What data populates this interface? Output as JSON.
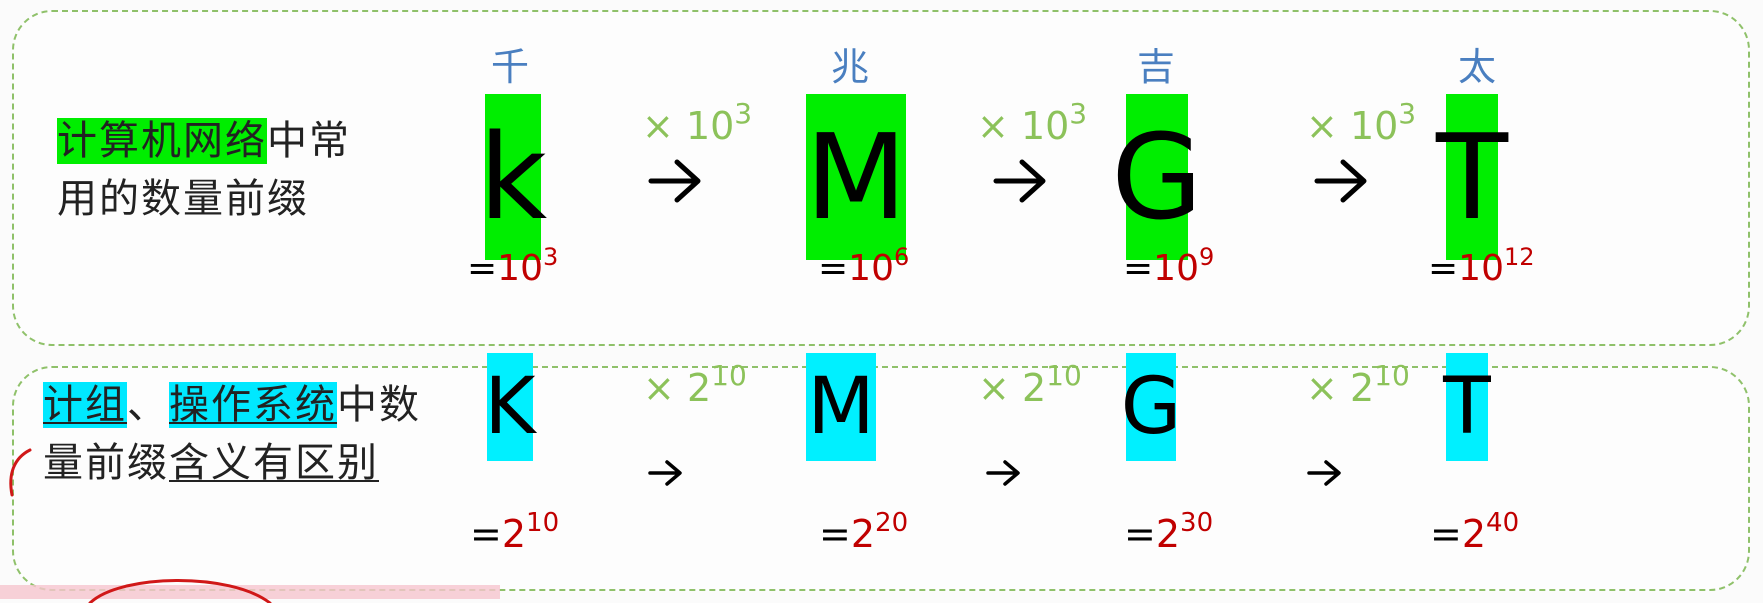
{
  "top": {
    "description": {
      "highlight": "计算机网络",
      "rest_line1": "中常",
      "line2": "用的数量前缀"
    },
    "prefixes": [
      {
        "chinese": "千",
        "letter": "k",
        "base": "10",
        "exp": "3"
      },
      {
        "chinese": "兆",
        "letter": "M",
        "base": "10",
        "exp": "6"
      },
      {
        "chinese": "吉",
        "letter": "G",
        "base": "10",
        "exp": "9"
      },
      {
        "chinese": "太",
        "letter": "T",
        "base": "10",
        "exp": "12"
      }
    ],
    "multiplier": {
      "sign": "×",
      "base": "10",
      "exp": "3"
    },
    "highlight_color": "#00ee00"
  },
  "bottom": {
    "description": {
      "hl1": "计组",
      "sep": "、",
      "hl2": "操作系统",
      "rest_line1": "中数",
      "line2_plain": "量前缀",
      "line2_underlined": "含义有区别"
    },
    "prefixes": [
      {
        "letter": "K",
        "base": "2",
        "exp": "10"
      },
      {
        "letter": "M",
        "base": "2",
        "exp": "20"
      },
      {
        "letter": "G",
        "base": "2",
        "exp": "30"
      },
      {
        "letter": "T",
        "base": "2",
        "exp": "40"
      }
    ],
    "multiplier": {
      "sign": "×",
      "base": "2",
      "exp": "10"
    },
    "highlight_color": "#00f0ff"
  },
  "equals_sign": "=",
  "arrow_icon": "right-arrow-icon",
  "colors": {
    "chinese_label": "#4a7fc0",
    "value": "#c00000",
    "multiplier": "#8cc25a",
    "border": "#8fc16a",
    "annotation": "#d01818"
  }
}
